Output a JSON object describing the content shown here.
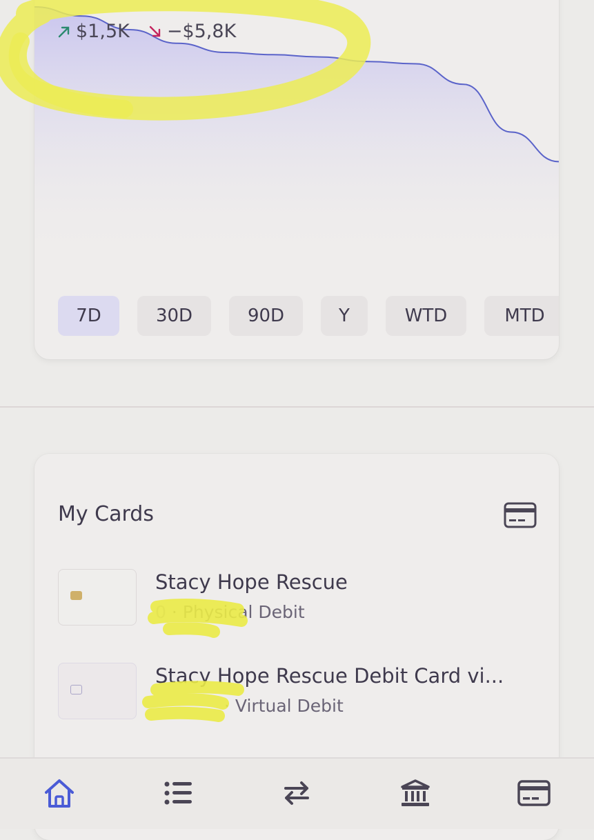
{
  "summary": {
    "incoming": "$1,5K",
    "outgoing": "−$5,8K",
    "incoming_color": "#2b8a6f",
    "outgoing_color": "#c4245e"
  },
  "time_ranges": [
    {
      "label": "7D",
      "active": true
    },
    {
      "label": "30D",
      "active": false
    },
    {
      "label": "90D",
      "active": false
    },
    {
      "label": "Y",
      "active": false
    },
    {
      "label": "WTD",
      "active": false
    },
    {
      "label": "MTD",
      "active": false
    }
  ],
  "chart_data": {
    "type": "area",
    "x": [
      0,
      1,
      2,
      3,
      4,
      5,
      6,
      7,
      8,
      9,
      10,
      11
    ],
    "y": [
      100,
      96,
      90,
      84,
      80,
      79,
      78,
      76,
      75,
      66,
      45,
      32
    ],
    "line_color": "#5a63c9",
    "fill_color": "#c9c6ee"
  },
  "my_cards": {
    "title": "My Cards",
    "header_icon": "credit-card-icon",
    "items": [
      {
        "name": "Stacy Hope Rescue",
        "last4": "0",
        "type": "Physical Debit",
        "kind": "physical"
      },
      {
        "name": "Stacy Hope Rescue Debit Card vi...",
        "last4": "",
        "type": "Virtual Debit",
        "kind": "virtual"
      }
    ]
  },
  "nav": {
    "items": [
      "home-icon",
      "list-icon",
      "transfer-icon",
      "bank-icon",
      "card-icon"
    ],
    "active_color": "#4a5bd6",
    "inactive_color": "#4a4555"
  }
}
